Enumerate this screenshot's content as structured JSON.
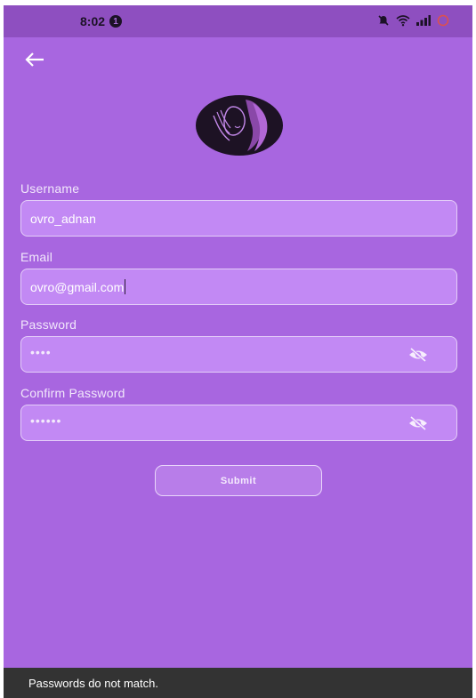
{
  "status_bar": {
    "time": "8:02",
    "notification_count": "1",
    "icons": [
      "bell-off-icon",
      "wifi-icon",
      "signal-icon",
      "battery-icon"
    ]
  },
  "nav": {
    "back_icon": "arrow-left-icon"
  },
  "form": {
    "username": {
      "label": "Username",
      "value": "ovro_adnan"
    },
    "email": {
      "label": "Email",
      "value": "ovro@gmail.com"
    },
    "password": {
      "label": "Password",
      "value": "••••",
      "toggle_icon": "eye-off-icon"
    },
    "confirm_password": {
      "label": "Confirm Password",
      "value": "••••••",
      "toggle_icon": "eye-off-icon"
    },
    "submit_label": "Submit"
  },
  "snackbar": {
    "message": "Passwords do not match."
  },
  "colors": {
    "background": "#a866e0",
    "status_bar": "#8e4fc0",
    "field_fill": "#c289f4",
    "snackbar": "#333333"
  }
}
